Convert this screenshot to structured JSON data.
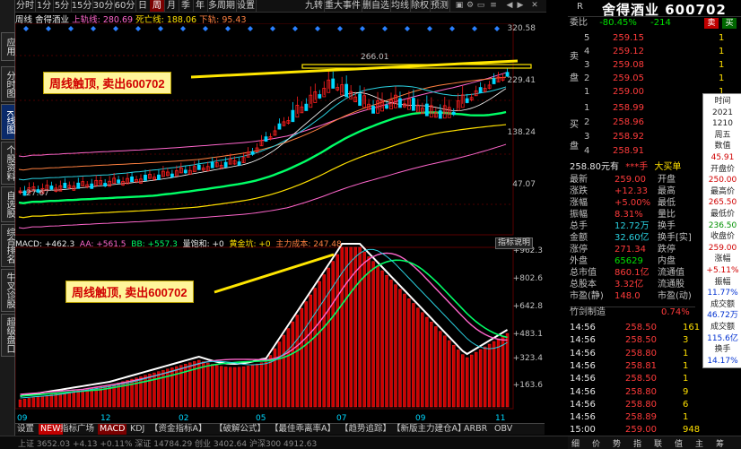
{
  "sidebar": {
    "items": [
      {
        "label": "应用"
      },
      {
        "label": "分时图"
      },
      {
        "label": "K线图"
      },
      {
        "label": "个股资料"
      },
      {
        "label": "自选股"
      },
      {
        "label": "综合排名"
      },
      {
        "label": "牛叉诊股"
      },
      {
        "label": "超级盘口"
      }
    ]
  },
  "toolbar": {
    "periods": [
      "分时",
      "1分",
      "5分",
      "15分",
      "30分",
      "60分",
      "日",
      "周",
      "月",
      "季",
      "年",
      "多周期",
      "设置"
    ],
    "active_period": "周",
    "tools": [
      "九转",
      "重大事件",
      "删自选",
      "均线",
      "除权",
      "预测"
    ]
  },
  "infoline": {
    "period": "周线",
    "stock": "舍得酒业",
    "up_line": "上轨线: 280.69",
    "dead_line": "死亡线: 188.06",
    "down_line": "下轨: 95.43"
  },
  "main_chart": {
    "y_labels": [
      "320.58",
      "229.41",
      "138.24",
      "47.07"
    ],
    "high_marker": "266.01",
    "low_marker": "27.67",
    "callout": "周线触顶, 卖出600702",
    "colors": {
      "up": "#ff2020",
      "down": "#00d8ff",
      "grid": "#5a0000",
      "mid": "#00ff66",
      "hline": "#ffe600"
    }
  },
  "sub_chart": {
    "header": {
      "macd": "MACD: +462.3",
      "aa": "AA: +561.5",
      "bb": "BB: +557.3",
      "vol": "量饱和: +0",
      "gold": "黄金坑: +0",
      "cost": "主力成本: 247.48"
    },
    "button": "指标说明",
    "y_labels": [
      "+962.3",
      "+802.6",
      "+642.8",
      "+483.1",
      "+323.4",
      "+163.6"
    ],
    "callout": "周线触顶, 卖出600702"
  },
  "x_axis": {
    "labels": [
      "09",
      "12",
      "02",
      "05",
      "07",
      "09",
      "11"
    ]
  },
  "bottom_tabs": [
    "设置",
    "NEW",
    "指标广场",
    "MACD",
    "KDJ",
    "【资金指标A】",
    "【破解公式】",
    "【最佳乖离率A】",
    "【趋势追踪】",
    "【新版主力建仓A】",
    "ARBR",
    "OBV"
  ],
  "status_bar": {
    "text": "上证 3652.03 +4.13 +0.11%   深证 14784.29   创业 3402.64   沪深300 4912.63"
  },
  "right_panel": {
    "code_prefix": "R",
    "title": "舍得酒业 600702",
    "weibi": {
      "label": "委比",
      "pct": "-80.45%",
      "val": "-214"
    },
    "sell_label": "卖盘",
    "buy_label": "买盘",
    "sells": [
      {
        "lvl": "5",
        "price": "259.15",
        "vol": "1"
      },
      {
        "lvl": "4",
        "price": "259.12",
        "vol": "1"
      },
      {
        "lvl": "3",
        "price": "259.08",
        "vol": "1"
      },
      {
        "lvl": "2",
        "price": "259.05",
        "vol": "1"
      },
      {
        "lvl": "1",
        "price": "259.00",
        "vol": "1"
      }
    ],
    "buys": [
      {
        "lvl": "1",
        "price": "258.99",
        "vol": "1"
      },
      {
        "lvl": "2",
        "price": "258.96",
        "vol": "1"
      },
      {
        "lvl": "3",
        "price": "258.92",
        "vol": "1"
      },
      {
        "lvl": "4",
        "price": "258.91",
        "vol": "1"
      }
    ],
    "big_buy": {
      "price": "258.80元有",
      "mid": "***手",
      "label": "大买单"
    },
    "stats": [
      [
        "最新",
        "259.00",
        "开盘",
        ""
      ],
      [
        "涨跌",
        "+12.33",
        "最高",
        ""
      ],
      [
        "涨幅",
        "+5.00%",
        "最低",
        ""
      ],
      [
        "振幅",
        "8.31%",
        "量比",
        ""
      ],
      [
        "总手",
        "12.72万",
        "换手",
        ""
      ],
      [
        "金额",
        "32.60亿",
        "换手[实]",
        ""
      ],
      [
        "涨停",
        "271.34",
        "跌停",
        ""
      ],
      [
        "外盘",
        "65629",
        "内盘",
        ""
      ],
      [
        "总市值",
        "860.1亿",
        "流通值",
        ""
      ],
      [
        "总股本",
        "3.32亿",
        "流通股",
        ""
      ],
      [
        "市盈(静)",
        "148.0",
        "市盈(动)",
        ""
      ]
    ],
    "ratio": {
      "label": "竹剑制造",
      "val": "0.74%"
    },
    "ticks": [
      {
        "t": "14:56",
        "p": "258.50",
        "v": "161"
      },
      {
        "t": "14:56",
        "p": "258.50",
        "v": "3"
      },
      {
        "t": "14:56",
        "p": "258.80",
        "v": "1"
      },
      {
        "t": "14:56",
        "p": "258.81",
        "v": "1"
      },
      {
        "t": "14:56",
        "p": "258.50",
        "v": "1"
      },
      {
        "t": "14:56",
        "p": "258.80",
        "v": "9"
      },
      {
        "t": "14:56",
        "p": "258.80",
        "v": "6"
      },
      {
        "t": "14:56",
        "p": "258.89",
        "v": "1"
      },
      {
        "t": "15:00",
        "p": "259.00",
        "v": "948"
      }
    ],
    "bottom_tabs": [
      "细",
      "价",
      "势",
      "指",
      "联",
      "值",
      "主",
      "筹"
    ]
  },
  "tooltip": {
    "rows": [
      [
        "时间",
        "black"
      ],
      [
        "2021",
        "black"
      ],
      [
        "1210",
        "black"
      ],
      [
        "周五",
        "black"
      ],
      [
        "数值",
        "black"
      ],
      [
        "45.91",
        "red"
      ],
      [
        "开盘价",
        "black"
      ],
      [
        "250.00",
        "red"
      ],
      [
        "最高价",
        "black"
      ],
      [
        "265.50",
        "red"
      ],
      [
        "最低价",
        "black"
      ],
      [
        "236.50",
        "green"
      ],
      [
        "收盘价",
        "black"
      ],
      [
        "259.00",
        "red"
      ],
      [
        "涨幅",
        "black"
      ],
      [
        "+5.11%",
        "red"
      ],
      [
        "振幅",
        "black"
      ],
      [
        "11.77%",
        "blue"
      ],
      [
        "成交额",
        "black"
      ],
      [
        "46.72万",
        "blue"
      ],
      [
        "成交额",
        "black"
      ],
      [
        "115.6亿",
        "blue"
      ],
      [
        "换手",
        "black"
      ],
      [
        "14.17%",
        "blue"
      ]
    ]
  }
}
